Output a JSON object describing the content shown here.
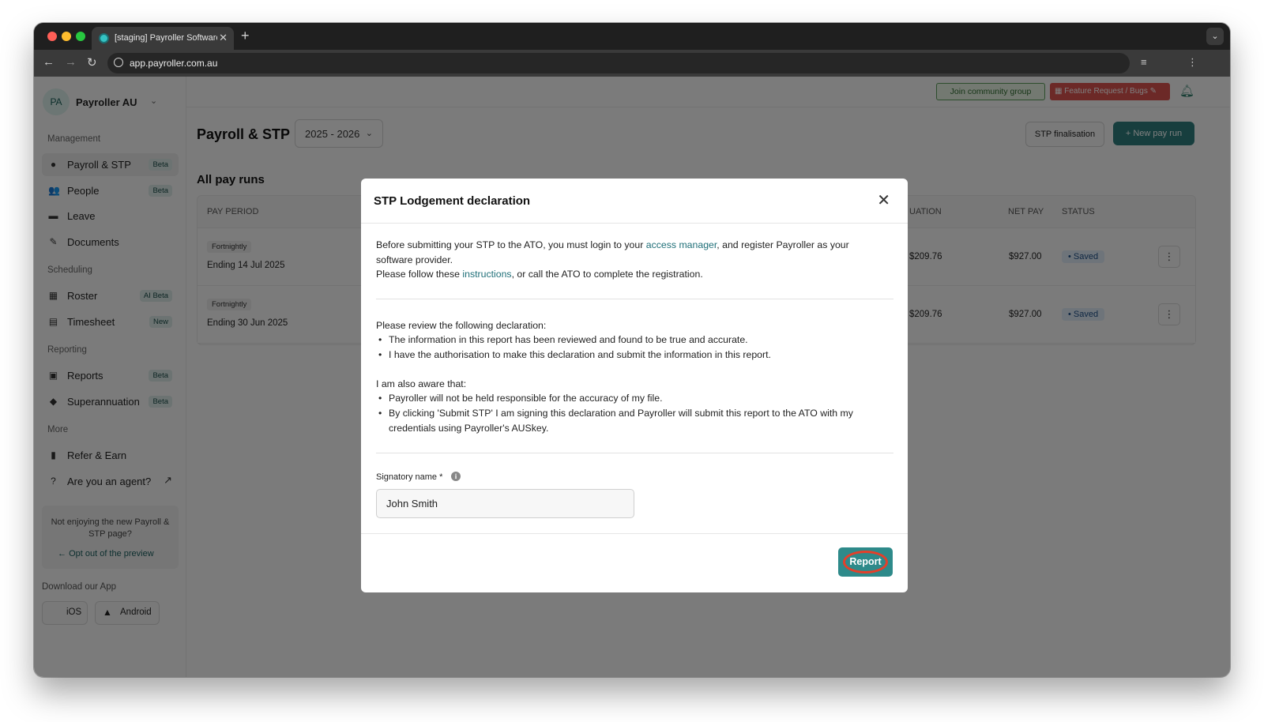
{
  "browser": {
    "tab_title": "[staging] Payroller Software",
    "url": "app.payroller.com.au"
  },
  "sidebar": {
    "org_initials": "PA",
    "org_name": "Payroller AU",
    "sections": {
      "management": "Management",
      "scheduling": "Scheduling",
      "reporting": "Reporting",
      "more": "More"
    },
    "items": [
      {
        "label": "Payroll & STP",
        "badge": "Beta",
        "icon": "payroll-icon"
      },
      {
        "label": "People",
        "badge": "Beta",
        "icon": "people-icon"
      },
      {
        "label": "Leave",
        "badge": "",
        "icon": "leave-icon"
      },
      {
        "label": "Documents",
        "badge": "",
        "icon": "documents-icon"
      },
      {
        "label": "Roster",
        "badge": "AI Beta",
        "icon": "roster-icon"
      },
      {
        "label": "Timesheet",
        "badge": "New",
        "icon": "timesheet-icon"
      },
      {
        "label": "Reports",
        "badge": "Beta",
        "icon": "reports-icon"
      },
      {
        "label": "Superannuation",
        "badge": "Beta",
        "icon": "superannuation-icon"
      },
      {
        "label": "Refer & Earn",
        "badge": "",
        "icon": "refer-icon"
      },
      {
        "label": "Are you an agent?",
        "badge": "",
        "icon": "help-icon"
      }
    ],
    "optout_text": "Not enjoying the new Payroll & STP page?",
    "optout_link": "Opt out of the preview",
    "download_label": "Download our App",
    "ios_label": "iOS",
    "android_label": "Android"
  },
  "topbar": {
    "community": "Join community group",
    "feature": "Feature Request / Bugs"
  },
  "page": {
    "title": "Payroll & STP",
    "year": "2025 - 2026",
    "stp_finalisation": "STP finalisation",
    "new_pay_run": "New pay run",
    "section_title": "All pay runs"
  },
  "table": {
    "headers": {
      "pay_period": "PAY PERIOD",
      "super": "UATION",
      "net_pay": "NET PAY",
      "status": "STATUS"
    },
    "rows": [
      {
        "frequency": "Fortnightly",
        "period": "Ending 14 Jul 2025",
        "super": "$209.76",
        "net_pay": "$927.00",
        "status": "Saved"
      },
      {
        "frequency": "Fortnightly",
        "period": "Ending 30 Jun 2025",
        "super": "$209.76",
        "net_pay": "$927.00",
        "status": "Saved"
      }
    ]
  },
  "modal": {
    "title": "STP Lodgement declaration",
    "intro_1a": "Before submitting your STP to the ATO, you must login to your ",
    "intro_link1": "access manager",
    "intro_1b": ", and register Payroller as your software provider.",
    "intro_2a": "Please follow these ",
    "intro_link2": "instructions",
    "intro_2b": ", or call the ATO to complete the registration.",
    "review_heading": "Please review the following declaration:",
    "review_bullets": [
      "The information in this report has been reviewed and found to be true and accurate.",
      "I have the authorisation to make this declaration and submit the information in this report."
    ],
    "aware_heading": "I am also aware that:",
    "aware_bullets": [
      "Payroller will not be held responsible for the accuracy of my file.",
      "By clicking 'Submit STP' I am signing this declaration and Payroller will submit this report to the ATO with my credentials using Payroller's AUSkey."
    ],
    "signatory_label": "Signatory name *",
    "signatory_value": "John Smith",
    "report_button": "Report"
  },
  "colors": {
    "accent": "#2e7d7d",
    "report_ring": "#e53f2a",
    "status_saved": "#1f4f86"
  }
}
